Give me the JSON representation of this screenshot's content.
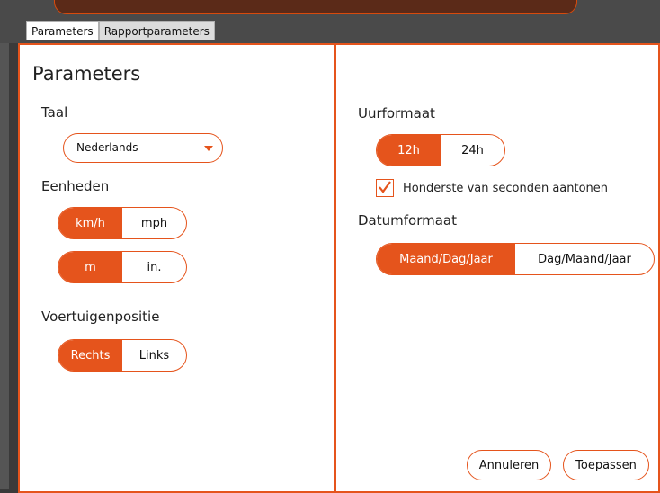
{
  "tabs": [
    {
      "label": "Parameters",
      "active": true
    },
    {
      "label": "Rapportparameters",
      "active": false
    }
  ],
  "left": {
    "title": "Parameters",
    "language": {
      "label": "Taal",
      "value": "Nederlands"
    },
    "units": {
      "label": "Eenheden",
      "speed": {
        "options": [
          "km/h",
          "mph"
        ],
        "selected": "km/h"
      },
      "distance": {
        "options": [
          "m",
          "in."
        ],
        "selected": "m"
      }
    },
    "vehicle_position": {
      "label": "Voertuigenpositie",
      "options": [
        "Rechts",
        "Links"
      ],
      "selected": "Rechts"
    }
  },
  "right": {
    "time_format": {
      "label": "Uurformaat",
      "options": [
        "12h",
        "24h"
      ],
      "selected": "12h"
    },
    "hundredths": {
      "label": "Honderste van seconden aantonen",
      "checked": true
    },
    "date_format": {
      "label": "Datumformaat",
      "options": [
        "Maand/Dag/Jaar",
        "Dag/Maand/Jaar"
      ],
      "selected": "Maand/Dag/Jaar"
    },
    "cancel_label": "Annuleren",
    "apply_label": "Toepassen"
  },
  "colors": {
    "accent": "#e5541c"
  }
}
